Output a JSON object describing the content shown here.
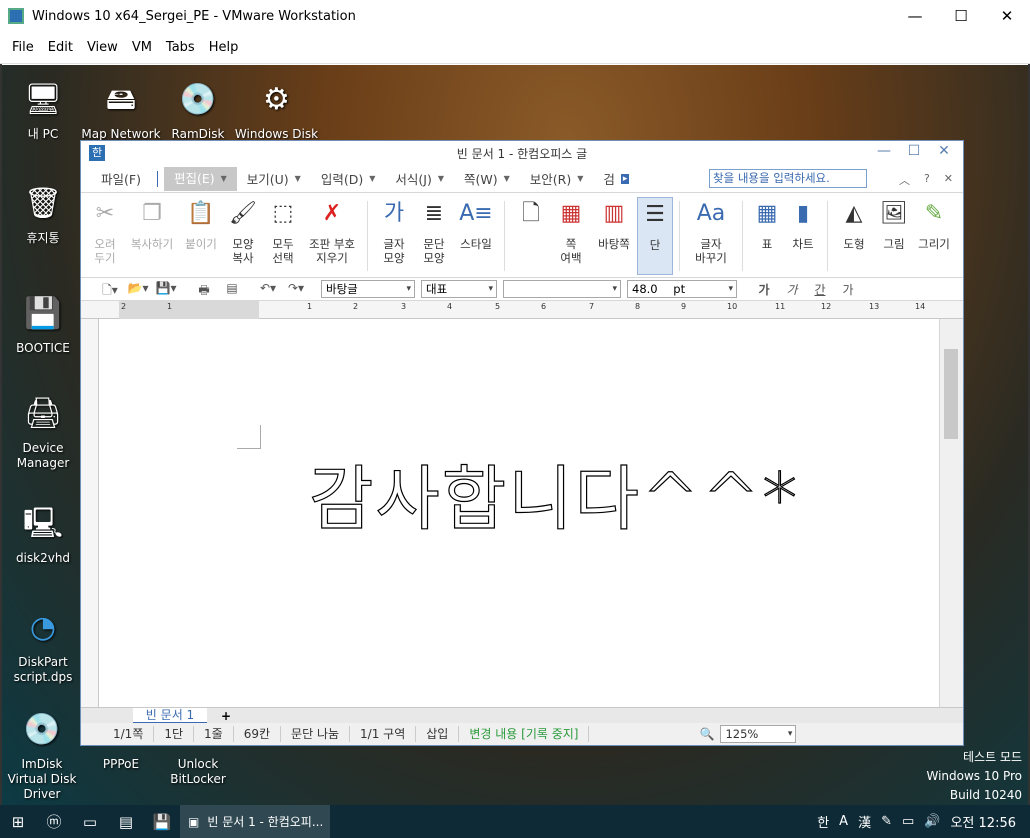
{
  "vm": {
    "title": "Windows 10 x64_Sergei_PE - VMware Workstation",
    "menu": [
      "File",
      "Edit",
      "View",
      "VM",
      "Tabs",
      "Help"
    ]
  },
  "desktop_icons": [
    {
      "label": "내 PC",
      "icon": "pc-icon"
    },
    {
      "label": "Map Network",
      "icon": "network-drive-icon"
    },
    {
      "label": "RamDisk",
      "icon": "disc-icon"
    },
    {
      "label": "Windows Disk",
      "icon": "disk-gear-icon"
    },
    {
      "label": "휴지통",
      "icon": "recycle-bin-icon"
    },
    {
      "label": "BOOTICE",
      "icon": "bootice-icon"
    },
    {
      "label": "Device Manager",
      "icon": "device-manager-icon"
    },
    {
      "label": "disk2vhd",
      "icon": "disk2vhd-icon"
    },
    {
      "label": "DiskPart script.dps",
      "icon": "diskpart-icon"
    },
    {
      "label": "ImDisk Virtual Disk Driver",
      "icon": "imdisk-icon"
    },
    {
      "label": "PPPoE",
      "icon": "pppoe-icon"
    },
    {
      "label": "Unlock BitLocker",
      "icon": "bitlocker-icon"
    }
  ],
  "watermark": {
    "line1": "테스트 모드",
    "line2": "Windows 10 Pro",
    "line3": "Build 10240"
  },
  "hwp": {
    "title": "빈 문서 1 - 한컴오피스    글",
    "menus": [
      "파일(F)",
      "편집(E)",
      "보기(U)",
      "입력(D)",
      "서식(J)",
      "쪽(W)",
      "보안(R)",
      "검"
    ],
    "search_placeholder": "찾을 내용을 입력하세요.",
    "ribbon": {
      "cut": "오려\n두기",
      "copy": "복사하기",
      "paste": "붙이기",
      "shape_copy": "모양\n복사",
      "select_all": "모두\n선택",
      "clear_marks": "조판 부호\n지우기",
      "char_shape": "글자\n모양",
      "para_shape": "문단\n모양",
      "style": "스타일",
      "page_margin": "쪽\n여백",
      "background_page": "바탕쪽",
      "columns": "단",
      "change_char": "글자\n바꾸기",
      "table": "표",
      "chart": "차트",
      "shape": "도형",
      "picture": "그림",
      "draw": "그리기"
    },
    "toolbar": {
      "style_value": "바탕글",
      "lang_value": "대표",
      "font_value": "",
      "size_value": "48.0",
      "size_unit": "pt",
      "bold": "가",
      "italic": "가",
      "underline": "간",
      "strike": "가"
    },
    "ruler_numbers": [
      "2",
      "1",
      "1",
      "2",
      "3",
      "4",
      "5",
      "6",
      "7",
      "8",
      "9",
      "10",
      "11",
      "12",
      "13",
      "14"
    ],
    "document_text": "감사합니다^^*",
    "doc_tab": "빈 문서 1",
    "status": {
      "page": "1/1쪽",
      "column": "1단",
      "line": "1줄",
      "col_pos": "69칸",
      "para_split": "문단 나눔",
      "section": "1/1 구역",
      "insert": "삽입",
      "track": "변경 내용 [기록 중지]",
      "zoom": "125%"
    }
  },
  "taskbar": {
    "task_label": "빈 문서 1 - 한컴오피...",
    "ime1": "한",
    "ime2": "A",
    "ime3": "漢",
    "time": "오전 12:56"
  }
}
